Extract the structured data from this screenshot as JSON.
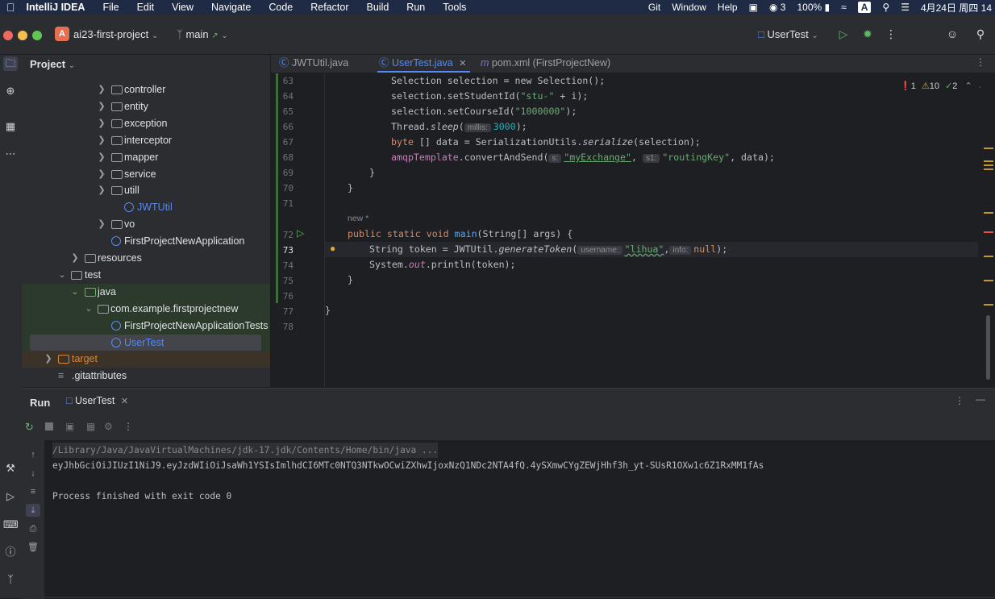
{
  "menubar": {
    "app": "IntelliJ IDEA",
    "items": [
      "File",
      "Edit",
      "View",
      "Navigate",
      "Code",
      "Refactor",
      "Build",
      "Run",
      "Tools"
    ],
    "right_items": [
      "Git",
      "Window",
      "Help"
    ],
    "wechat_count": "3",
    "battery": "100%",
    "input_method": "A",
    "datetime": "4月24日 周四 14"
  },
  "titlebar": {
    "project_badge": "A",
    "project_name": "ai23-first-project",
    "branch": "main",
    "run_config": "UserTest"
  },
  "project_panel": {
    "title": "Project",
    "tree": [
      {
        "label": "controller",
        "kind": "folder"
      },
      {
        "label": "entity",
        "kind": "folder"
      },
      {
        "label": "exception",
        "kind": "folder"
      },
      {
        "label": "interceptor",
        "kind": "folder"
      },
      {
        "label": "mapper",
        "kind": "folder"
      },
      {
        "label": "service",
        "kind": "folder"
      },
      {
        "label": "utill",
        "kind": "folder"
      },
      {
        "label": "JWTUtil",
        "kind": "class"
      },
      {
        "label": "vo",
        "kind": "folder"
      },
      {
        "label": "FirstProjectNewApplication",
        "kind": "class"
      },
      {
        "label": "resources",
        "kind": "folder"
      },
      {
        "label": "test",
        "kind": "folder"
      },
      {
        "label": "java",
        "kind": "folder"
      },
      {
        "label": "com.example.firstprojectnew",
        "kind": "package"
      },
      {
        "label": "FirstProjectNewApplicationTests",
        "kind": "class"
      },
      {
        "label": "UserTest",
        "kind": "class"
      },
      {
        "label": "target",
        "kind": "folder"
      },
      {
        "label": ".gitattributes",
        "kind": "file"
      }
    ]
  },
  "editor": {
    "tabs": [
      {
        "label": "JWTUtil.java",
        "active": false
      },
      {
        "label": "UserTest.java",
        "active": true
      },
      {
        "label": "pom.xml (FirstProjectNew)",
        "active": false
      }
    ],
    "inspections": {
      "errors": "1",
      "warnings": "10",
      "ok": "2"
    },
    "line_numbers": [
      "63",
      "64",
      "65",
      "66",
      "67",
      "68",
      "69",
      "70",
      "71",
      "72",
      "73",
      "74",
      "75",
      "76",
      "77",
      "78"
    ],
    "new_marker": "new *",
    "code": {
      "l63": "Selection selection = new Selection();",
      "l64a": "selection.setStudentId(",
      "l64s": "\"stu-\"",
      "l64b": " + i);",
      "l65a": "selection.setCourseId(",
      "l65s": "\"1000000\"",
      "l65b": ");",
      "l66a": "Thread.",
      "l66f": "sleep",
      "l66b": "(",
      "l66h": "millis:",
      "l66n": "3000",
      "l66c": ");",
      "l67a": "byte",
      "l67b": " [] data = SerializationUtils.",
      "l67f": "serialize",
      "l67c": "(selection);",
      "l68a": "amqpTemplate",
      "l68b": ".convertAndSend(",
      "l68h1": "s:",
      "l68s1": "\"myExchange\"",
      "l68c": ", ",
      "l68h2": "s1:",
      "l68s2": "\"routingKey\"",
      "l68d": ", data);",
      "l69": "}",
      "l70": "}",
      "l72k": "public static void ",
      "l72f": "main",
      "l72b": "(String[] args) {",
      "l73a": "String token = JWTUtil.",
      "l73f": "generateToken",
      "l73b": "(",
      "l73h1": "username:",
      "l73s": "\"lihua\"",
      "l73c": ",",
      "l73h2": "info:",
      "l73k": "null",
      "l73d": ");",
      "l74a": "System.",
      "l74f": "out",
      "l74b": ".println(token);",
      "l75": "}",
      "l77": "}"
    }
  },
  "run_panel": {
    "title": "Run",
    "tab": "UserTest",
    "console": {
      "path": "/Library/Java/JavaVirtualMachines/jdk-17.jdk/Contents/Home/bin/java ...",
      "token": "eyJhbGciOiJIUzI1NiJ9.eyJzdWIiOiJsaWh1YSIsImlhdCI6MTc0NTQ3NTkwOCwiZXhwIjoxNzQ1NDc2NTA4fQ.4ySXmwCYgZEWjHhf3h_yt-SUsR1OXw1c6Z1RxMM1fAs",
      "exit": "Process finished with exit code 0"
    }
  },
  "colors": {
    "accent": "#548af7",
    "run_green": "#5fb865",
    "error_red": "#e5534b",
    "warning_yellow": "#e0a93b"
  }
}
